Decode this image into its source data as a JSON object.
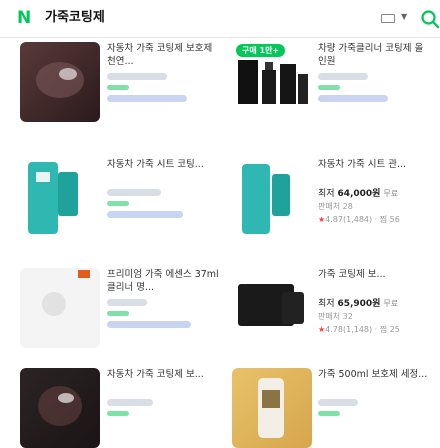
{
  "header": {
    "logo_letter": "N",
    "query": "가죽코팅제",
    "search_icon": "search-icon",
    "keyboard_icon": "keyboard-icon",
    "brand_color": "#03c75a"
  },
  "badge": {
    "label": "구매 1만+"
  },
  "products": [
    {
      "title": "자동차 가죽 코팅제 보호제 천연...",
      "price": "",
      "sales": "",
      "rating": ""
    },
    {
      "title": "차량 가죽클리너 코팅제 올인원",
      "price": "",
      "sales": "",
      "rating": ""
    },
    {
      "title": "자동차 가죽 시트 코팅...",
      "price": "",
      "sales": "",
      "rating": ""
    },
    {
      "title": "자동차 가죽 시트 관...",
      "price_label": "최저",
      "price": "64,000원",
      "shipping": "무료",
      "sales": "판매처 28",
      "rating": "4.87(1,484) · 찜 56"
    },
    {
      "title": "프리미엄 가죽 에센스 37ml 클리너 명...",
      "price": "",
      "sales": "",
      "rating": ""
    },
    {
      "title": "가죽 코팅제 보...",
      "price_label": "최저",
      "price": "65,900원",
      "shipping": "무료",
      "sales": "판매처 32",
      "rating": "4.78(1,148) · 찜 25"
    },
    {
      "title": "자동차 가죽 코팅제 보...",
      "price": "",
      "sales": "",
      "rating": ""
    },
    {
      "title": "가죽 500ml 보호제 세정...",
      "price": "",
      "sales": "",
      "rating": ""
    }
  ]
}
